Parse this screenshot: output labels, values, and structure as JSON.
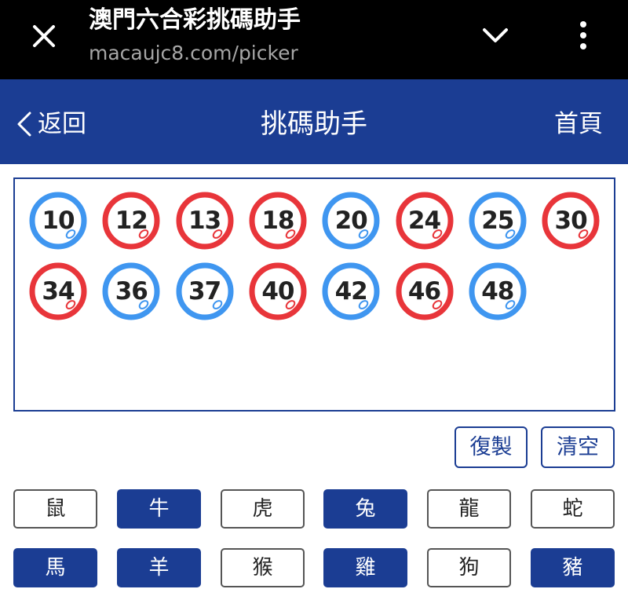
{
  "browser": {
    "title": "澳門六合彩挑碼助手",
    "url": "macaujc8.com/picker",
    "close_icon": "close-icon",
    "chevron_icon": "chevron-down-icon",
    "menu_icon": "more-vert-icon"
  },
  "header": {
    "back_label": "返回",
    "title": "挑碼助手",
    "home_label": "首頁",
    "background": "#1b3d93"
  },
  "selected_numbers": [
    {
      "number": "10",
      "color": "blue"
    },
    {
      "number": "12",
      "color": "red"
    },
    {
      "number": "13",
      "color": "red"
    },
    {
      "number": "18",
      "color": "red"
    },
    {
      "number": "20",
      "color": "blue"
    },
    {
      "number": "24",
      "color": "red"
    },
    {
      "number": "25",
      "color": "blue"
    },
    {
      "number": "30",
      "color": "red"
    },
    {
      "number": "34",
      "color": "red"
    },
    {
      "number": "36",
      "color": "blue"
    },
    {
      "number": "37",
      "color": "blue"
    },
    {
      "number": "40",
      "color": "red"
    },
    {
      "number": "42",
      "color": "blue"
    },
    {
      "number": "46",
      "color": "red"
    },
    {
      "number": "48",
      "color": "blue"
    }
  ],
  "ball_colors": {
    "red": "#e8353a",
    "blue": "#3f96f0"
  },
  "actions": {
    "copy_label": "復製",
    "clear_label": "清空"
  },
  "zodiacs": [
    {
      "label": "鼠",
      "selected": false
    },
    {
      "label": "牛",
      "selected": true
    },
    {
      "label": "虎",
      "selected": false
    },
    {
      "label": "兔",
      "selected": true
    },
    {
      "label": "龍",
      "selected": false
    },
    {
      "label": "蛇",
      "selected": false
    },
    {
      "label": "馬",
      "selected": true
    },
    {
      "label": "羊",
      "selected": true
    },
    {
      "label": "猴",
      "selected": false
    },
    {
      "label": "雞",
      "selected": true
    },
    {
      "label": "狗",
      "selected": false
    },
    {
      "label": "豬",
      "selected": true
    }
  ]
}
